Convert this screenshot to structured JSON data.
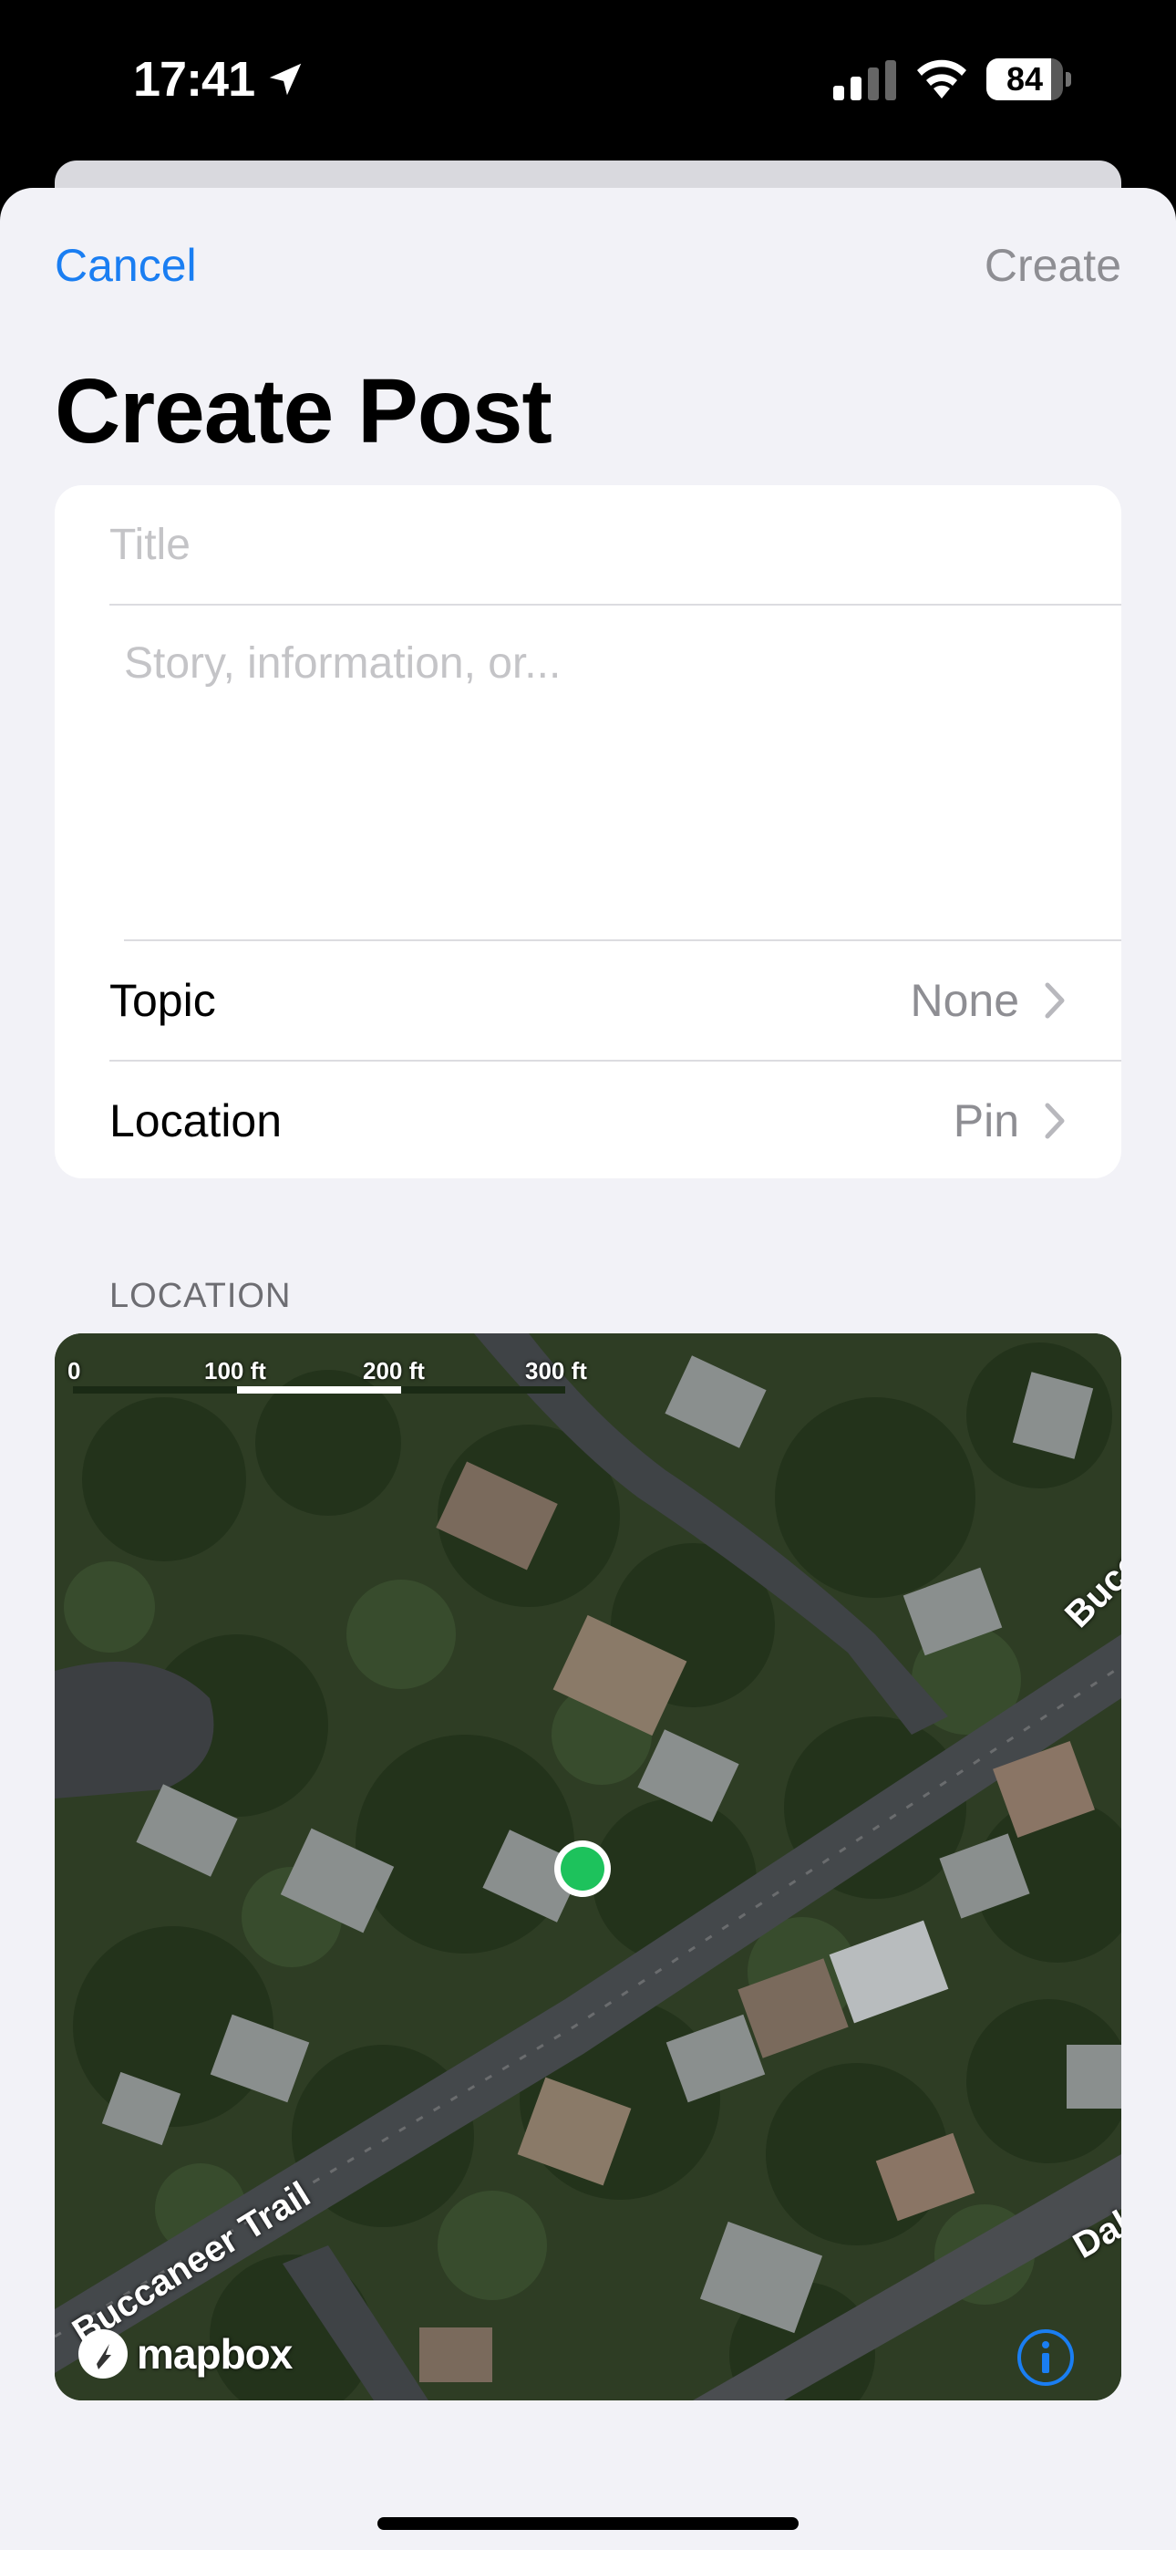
{
  "status_bar": {
    "time": "17:41",
    "battery_percent": "84",
    "battery_level": 0.84,
    "icons": [
      "location-arrow-icon",
      "cellular-signal-icon",
      "wifi-icon",
      "battery-icon"
    ]
  },
  "nav": {
    "cancel_label": "Cancel",
    "create_label": "Create"
  },
  "page": {
    "title": "Create Post"
  },
  "form": {
    "title_placeholder": "Title",
    "title_value": "",
    "story_placeholder": "Story, information, or...",
    "story_value": "",
    "topic_label": "Topic",
    "topic_value": "None",
    "location_label": "Location",
    "location_value": "Pin"
  },
  "location_section": {
    "header": "LOCATION",
    "scale": {
      "zero": "0",
      "mark_100": "100 ft",
      "mark_200": "200 ft",
      "mark_300": "300 ft"
    },
    "streets": {
      "buccaneer_trail": "Buccaneer Trail",
      "bucca_partial": "Bucca",
      "dal_partial": "Dal"
    },
    "attribution": "mapbox",
    "pin_color": "#1dc25c"
  },
  "colors": {
    "accent": "#1a7ef2",
    "disabled": "#8e8e93",
    "background": "#f2f2f7"
  }
}
